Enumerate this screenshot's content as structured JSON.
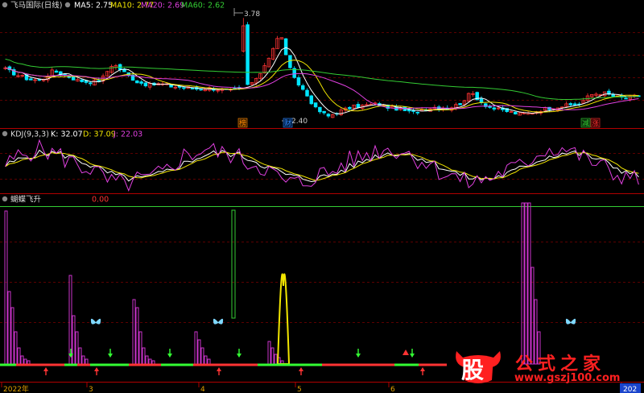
{
  "main_panel": {
    "title": "飞马国际(日线)",
    "ma_labels": [
      {
        "text": "MA5: 2.75",
        "color": "#ffffff"
      },
      {
        "text": "MA10: 2.77",
        "color": "#f2e600"
      },
      {
        "text": "MA20: 2.69",
        "color": "#e040e0"
      },
      {
        "text": "MA60: 2.62",
        "color": "#33cc33"
      }
    ],
    "high_annotation": "3.78",
    "low_annotation": "2.40",
    "event_badges": [
      {
        "text": "榜",
        "color": "#ff8800"
      },
      {
        "text": "财",
        "color": "#3388ff"
      },
      {
        "text": "减",
        "color": "#33cc33"
      },
      {
        "text": "涨",
        "color": "#ff3333"
      }
    ]
  },
  "kdj_panel": {
    "title": "KDJ(9,3,3)",
    "k_label": "K: 32.07",
    "d_label": "D: 37.09",
    "j_label": "J: 22.03"
  },
  "butterfly_panel": {
    "title": "蝴蝶飞升",
    "value_label": "0.00"
  },
  "x_axis": {
    "labels": [
      "2022年",
      "3",
      "4",
      "5",
      "6",
      "202"
    ]
  },
  "watermark": {
    "logo_char": "股",
    "title": "公式之家",
    "url": "www.gszj100.com"
  },
  "colors": {
    "background": "#000000",
    "up_candle": "#ff3333",
    "down_candle": "#00e5ff",
    "grid": "#7a0000",
    "ma5": "#ffffff",
    "ma10": "#f2e600",
    "ma20": "#e040e0",
    "ma60": "#33cc33",
    "kdj_k": "#ffffff",
    "kdj_d": "#f2e600",
    "kdj_j": "#e040e0",
    "histogram": "#cc33cc",
    "signal_up": "#ff3333",
    "signal_down": "#33ff33",
    "butterfly": "#7fd8ff"
  },
  "chart_data": {
    "type": "candlestick",
    "title": "飞马国际(日线)",
    "x_tick_labels": [
      "2022年",
      "3",
      "4",
      "5",
      "6",
      "202"
    ],
    "y_range": [
      2.3,
      3.9
    ],
    "ohlc_anchor_closes": [
      3.1,
      3.02,
      2.96,
      2.95,
      3.08,
      3.02,
      2.95,
      2.92,
      2.95,
      3.18,
      3.05,
      2.93,
      2.88,
      2.9,
      2.86,
      2.85,
      2.83,
      2.84,
      2.82,
      2.8,
      2.86,
      2.95,
      3.25,
      3.6,
      3.0,
      2.8,
      2.55,
      2.45,
      2.52,
      2.58,
      2.6,
      2.62,
      2.58,
      2.55,
      2.5,
      2.55,
      2.58,
      2.56,
      2.62,
      2.78,
      2.62,
      2.55,
      2.52,
      2.48,
      2.5,
      2.55,
      2.58,
      2.6,
      2.62,
      2.75,
      2.78,
      2.72,
      2.7,
      2.74
    ],
    "high": 3.78,
    "low": 2.4,
    "kdj": {
      "K": 32.07,
      "D": 37.09,
      "J": 22.03
    },
    "butterfly_value": 0.0
  }
}
